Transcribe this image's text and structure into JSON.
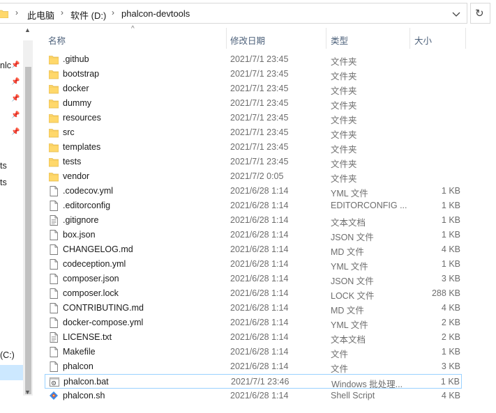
{
  "address": {
    "crumbs": [
      "此电脑",
      "软件 (D:)",
      "phalcon-devtools"
    ],
    "refresh_glyph": "↻",
    "dropdown_glyph": "⌄"
  },
  "nav": {
    "items": [
      "nlc",
      "ts",
      "ts",
      "(C:)"
    ]
  },
  "columns": {
    "name": "名称",
    "modified": "修改日期",
    "type": "类型",
    "size": "大小"
  },
  "files": [
    {
      "name": ".github",
      "modified": "2021/7/1 23:45",
      "type": "文件夹",
      "size": "",
      "icon": "folder-icon"
    },
    {
      "name": "bootstrap",
      "modified": "2021/7/1 23:45",
      "type": "文件夹",
      "size": "",
      "icon": "folder-icon"
    },
    {
      "name": "docker",
      "modified": "2021/7/1 23:45",
      "type": "文件夹",
      "size": "",
      "icon": "folder-icon"
    },
    {
      "name": "dummy",
      "modified": "2021/7/1 23:45",
      "type": "文件夹",
      "size": "",
      "icon": "folder-icon"
    },
    {
      "name": "resources",
      "modified": "2021/7/1 23:45",
      "type": "文件夹",
      "size": "",
      "icon": "folder-icon"
    },
    {
      "name": "src",
      "modified": "2021/7/1 23:45",
      "type": "文件夹",
      "size": "",
      "icon": "folder-icon"
    },
    {
      "name": "templates",
      "modified": "2021/7/1 23:45",
      "type": "文件夹",
      "size": "",
      "icon": "folder-icon"
    },
    {
      "name": "tests",
      "modified": "2021/7/1 23:45",
      "type": "文件夹",
      "size": "",
      "icon": "folder-icon"
    },
    {
      "name": "vendor",
      "modified": "2021/7/2 0:05",
      "type": "文件夹",
      "size": "",
      "icon": "folder-icon"
    },
    {
      "name": ".codecov.yml",
      "modified": "2021/6/28 1:14",
      "type": "YML 文件",
      "size": "1 KB",
      "icon": "file-icon"
    },
    {
      "name": ".editorconfig",
      "modified": "2021/6/28 1:14",
      "type": "EDITORCONFIG ...",
      "size": "1 KB",
      "icon": "file-icon"
    },
    {
      "name": ".gitignore",
      "modified": "2021/6/28 1:14",
      "type": "文本文档",
      "size": "1 KB",
      "icon": "text-file-icon"
    },
    {
      "name": "box.json",
      "modified": "2021/6/28 1:14",
      "type": "JSON 文件",
      "size": "1 KB",
      "icon": "file-icon"
    },
    {
      "name": "CHANGELOG.md",
      "modified": "2021/6/28 1:14",
      "type": "MD 文件",
      "size": "4 KB",
      "icon": "file-icon"
    },
    {
      "name": "codeception.yml",
      "modified": "2021/6/28 1:14",
      "type": "YML 文件",
      "size": "1 KB",
      "icon": "file-icon"
    },
    {
      "name": "composer.json",
      "modified": "2021/6/28 1:14",
      "type": "JSON 文件",
      "size": "3 KB",
      "icon": "file-icon"
    },
    {
      "name": "composer.lock",
      "modified": "2021/6/28 1:14",
      "type": "LOCK 文件",
      "size": "288 KB",
      "icon": "file-icon"
    },
    {
      "name": "CONTRIBUTING.md",
      "modified": "2021/6/28 1:14",
      "type": "MD 文件",
      "size": "4 KB",
      "icon": "file-icon"
    },
    {
      "name": "docker-compose.yml",
      "modified": "2021/6/28 1:14",
      "type": "YML 文件",
      "size": "2 KB",
      "icon": "file-icon"
    },
    {
      "name": "LICENSE.txt",
      "modified": "2021/6/28 1:14",
      "type": "文本文档",
      "size": "2 KB",
      "icon": "text-file-icon"
    },
    {
      "name": "Makefile",
      "modified": "2021/6/28 1:14",
      "type": "文件",
      "size": "1 KB",
      "icon": "file-icon"
    },
    {
      "name": "phalcon",
      "modified": "2021/6/28 1:14",
      "type": "文件",
      "size": "3 KB",
      "icon": "file-icon"
    },
    {
      "name": "phalcon.bat",
      "modified": "2021/7/1 23:46",
      "type": "Windows 批处理...",
      "size": "1 KB",
      "icon": "batch-file-icon",
      "selected": true
    },
    {
      "name": "phalcon.sh",
      "modified": "2021/6/28 1:14",
      "type": "Shell Script",
      "size": "4 KB",
      "icon": "shell-script-icon"
    }
  ],
  "colors": {
    "folder": "#ffd86b",
    "header_text": "#4c607a",
    "selection_border": "#99d1ff"
  }
}
